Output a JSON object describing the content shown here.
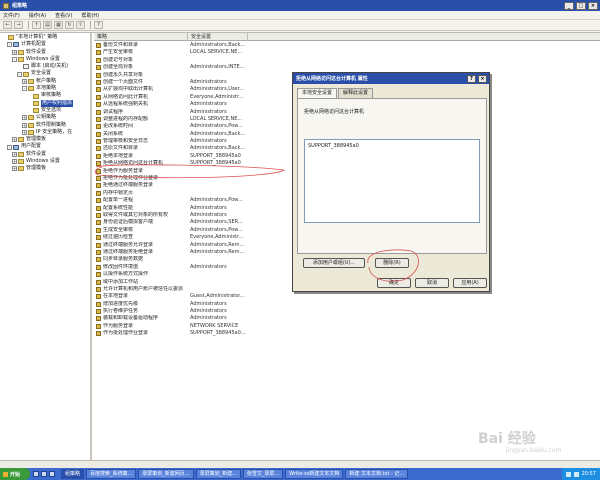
{
  "window": {
    "title": "组策略",
    "minimize": "_",
    "maximize": "□",
    "close": "×"
  },
  "menus": [
    "文件(F)",
    "操作(A)",
    "查看(V)",
    "帮助(H)"
  ],
  "toolbar_icons": [
    "back-icon",
    "forward-icon",
    "up-icon",
    "show-tree-icon",
    "properties-icon",
    "refresh-icon",
    "export-icon",
    "help-icon"
  ],
  "tree": [
    {
      "label": "\"本地计算机\" 策略",
      "indent": 0,
      "expander": "",
      "icon": "policy"
    },
    {
      "label": "计算机配置",
      "indent": 1,
      "expander": "-",
      "icon": "comp"
    },
    {
      "label": "软件设置",
      "indent": 2,
      "expander": "+",
      "icon": "folder"
    },
    {
      "label": "Windows 设置",
      "indent": 2,
      "expander": "-",
      "icon": "folder"
    },
    {
      "label": "脚本 (启动/关机)",
      "indent": 3,
      "expander": "",
      "icon": "doc"
    },
    {
      "label": "安全设置",
      "indent": 3,
      "expander": "-",
      "icon": "folder"
    },
    {
      "label": "帐户策略",
      "indent": 4,
      "expander": "+",
      "icon": "folder"
    },
    {
      "label": "本地策略",
      "indent": 4,
      "expander": "-",
      "icon": "folder"
    },
    {
      "label": "审核策略",
      "indent": 5,
      "expander": "",
      "icon": "folder"
    },
    {
      "label": "用户权利指派",
      "indent": 5,
      "expander": "",
      "icon": "folder",
      "selected": true
    },
    {
      "label": "安全选项",
      "indent": 5,
      "expander": "",
      "icon": "folder"
    },
    {
      "label": "公钥策略",
      "indent": 4,
      "expander": "+",
      "icon": "folder"
    },
    {
      "label": "软件限制策略",
      "indent": 4,
      "expander": "+",
      "icon": "folder"
    },
    {
      "label": "IP 安全策略，在",
      "indent": 4,
      "expander": "+",
      "icon": "folder"
    },
    {
      "label": "管理模板",
      "indent": 2,
      "expander": "+",
      "icon": "folder"
    },
    {
      "label": "用户配置",
      "indent": 1,
      "expander": "-",
      "icon": "comp"
    },
    {
      "label": "软件设置",
      "indent": 2,
      "expander": "+",
      "icon": "folder"
    },
    {
      "label": "Windows 设置",
      "indent": 2,
      "expander": "+",
      "icon": "folder"
    },
    {
      "label": "管理模板",
      "indent": 2,
      "expander": "+",
      "icon": "folder"
    }
  ],
  "list": {
    "headers": {
      "policy": "策略",
      "setting": "安全设置"
    },
    "rows": [
      {
        "policy": "备份文件和目录",
        "setting": "Administrators,Back..."
      },
      {
        "policy": "产生安全审核",
        "setting": "LOCAL SERVICE,NE..."
      },
      {
        "policy": "创建记号对象",
        "setting": ""
      },
      {
        "policy": "创建全局对象",
        "setting": "Administrators,INTE..."
      },
      {
        "policy": "创建永久共享对象",
        "setting": ""
      },
      {
        "policy": "创建一个页面文件",
        "setting": "Administrators"
      },
      {
        "policy": "从扩展坞中取出计算机",
        "setting": "Administrators,User..."
      },
      {
        "policy": "从网络访问此计算机",
        "setting": "Everyone,Administr..."
      },
      {
        "policy": "从远程系统强制关机",
        "setting": "Administrators"
      },
      {
        "policy": "调试程序",
        "setting": "Administrators"
      },
      {
        "policy": "调整进程的内存配额",
        "setting": "LOCAL SERVICE,NE..."
      },
      {
        "policy": "更改系统时间",
        "setting": "Administrators,Pow..."
      },
      {
        "policy": "关闭系统",
        "setting": "Administrators,Back..."
      },
      {
        "policy": "管理审核和安全日志",
        "setting": "Administrators"
      },
      {
        "policy": "还原文件和目录",
        "setting": "Administrators,Back..."
      },
      {
        "policy": "拒绝本地登录",
        "setting": "SUPPORT_388945a0"
      },
      {
        "policy": "拒绝从网络访问这台计算机",
        "setting": "SUPPORT_388945a0",
        "highlight": true
      },
      {
        "policy": "拒绝作为服务登录",
        "setting": ""
      },
      {
        "policy": "拒绝作为批处理作业登录",
        "setting": ""
      },
      {
        "policy": "拒绝通过终端服务登录",
        "setting": ""
      },
      {
        "policy": "内存中锁定页",
        "setting": ""
      },
      {
        "policy": "配置单一进程",
        "setting": "Administrators,Pow..."
      },
      {
        "policy": "配置系统性能",
        "setting": "Administrators"
      },
      {
        "policy": "取得文件或其它对象的所有权",
        "setting": "Administrators"
      },
      {
        "policy": "身份验证后模拟客户端",
        "setting": "Administrators,SER..."
      },
      {
        "policy": "生成安全审核",
        "setting": "Administrators,Pow..."
      },
      {
        "policy": "绕过遍历检查",
        "setting": "Everyone,Administr..."
      },
      {
        "policy": "通过终端服务允许登录",
        "setting": "Administrators,Rem..."
      },
      {
        "policy": "通过终端服务拒绝登录",
        "setting": "Administrators,Rem..."
      },
      {
        "policy": "同步目录服务数据",
        "setting": ""
      },
      {
        "policy": "修改固件环境值",
        "setting": "Administrators"
      },
      {
        "policy": "以操作系统方式操作",
        "setting": ""
      },
      {
        "policy": "域中添加工作站",
        "setting": ""
      },
      {
        "policy": "允许计算机和用户账户被信任以委派",
        "setting": ""
      },
      {
        "policy": "在本地登录",
        "setting": "Guest,Administrator..."
      },
      {
        "policy": "增加进度优先级",
        "setting": "Administrators"
      },
      {
        "policy": "执行卷维护任务",
        "setting": "Administrators"
      },
      {
        "policy": "装载和卸载设备驱动程序",
        "setting": "Administrators"
      },
      {
        "policy": "作为服务登录",
        "setting": "NETWORK SERVICE"
      },
      {
        "policy": "作为批处理作业登录",
        "setting": "SUPPORT_388945a0..."
      }
    ]
  },
  "dialog": {
    "title": "拒绝从网络访问这台计算机 属性",
    "help": "?",
    "close": "×",
    "tabs": [
      {
        "label": "本地安全设置",
        "active": true
      },
      {
        "label": "解释此设置",
        "active": false
      }
    ],
    "description": "拒绝从网络访问这台计算机",
    "users": [
      "SUPPORT_388945a0"
    ],
    "add_button": "添加用户或组(U)...",
    "remove_button": "删除(R)",
    "ok_button": "确定",
    "cancel_button": "取消",
    "apply_button": "应用(A)"
  },
  "taskbar": {
    "start": "开始",
    "tasks": [
      {
        "label": "组策略",
        "active": true
      },
      {
        "label": "百度搜索_系统策...",
        "active": false
      },
      {
        "label": "录屏策划_新建网页...",
        "active": false
      },
      {
        "label": "录屏策划_新建...",
        "active": false
      },
      {
        "label": "张雪文_录屏...",
        "active": false
      },
      {
        "label": "Write-ss新建文本文档",
        "active": false
      },
      {
        "label": "新建 文本文档.txt - 记...",
        "active": false
      }
    ],
    "clock": "20:57"
  },
  "watermark": {
    "text": "Bai 经验",
    "sub": "jingyan.baidu.com"
  },
  "colors": {
    "titlebar": "#2a4fa8",
    "annotation": "#d9534f",
    "taskbar": "#3c6bd0"
  }
}
